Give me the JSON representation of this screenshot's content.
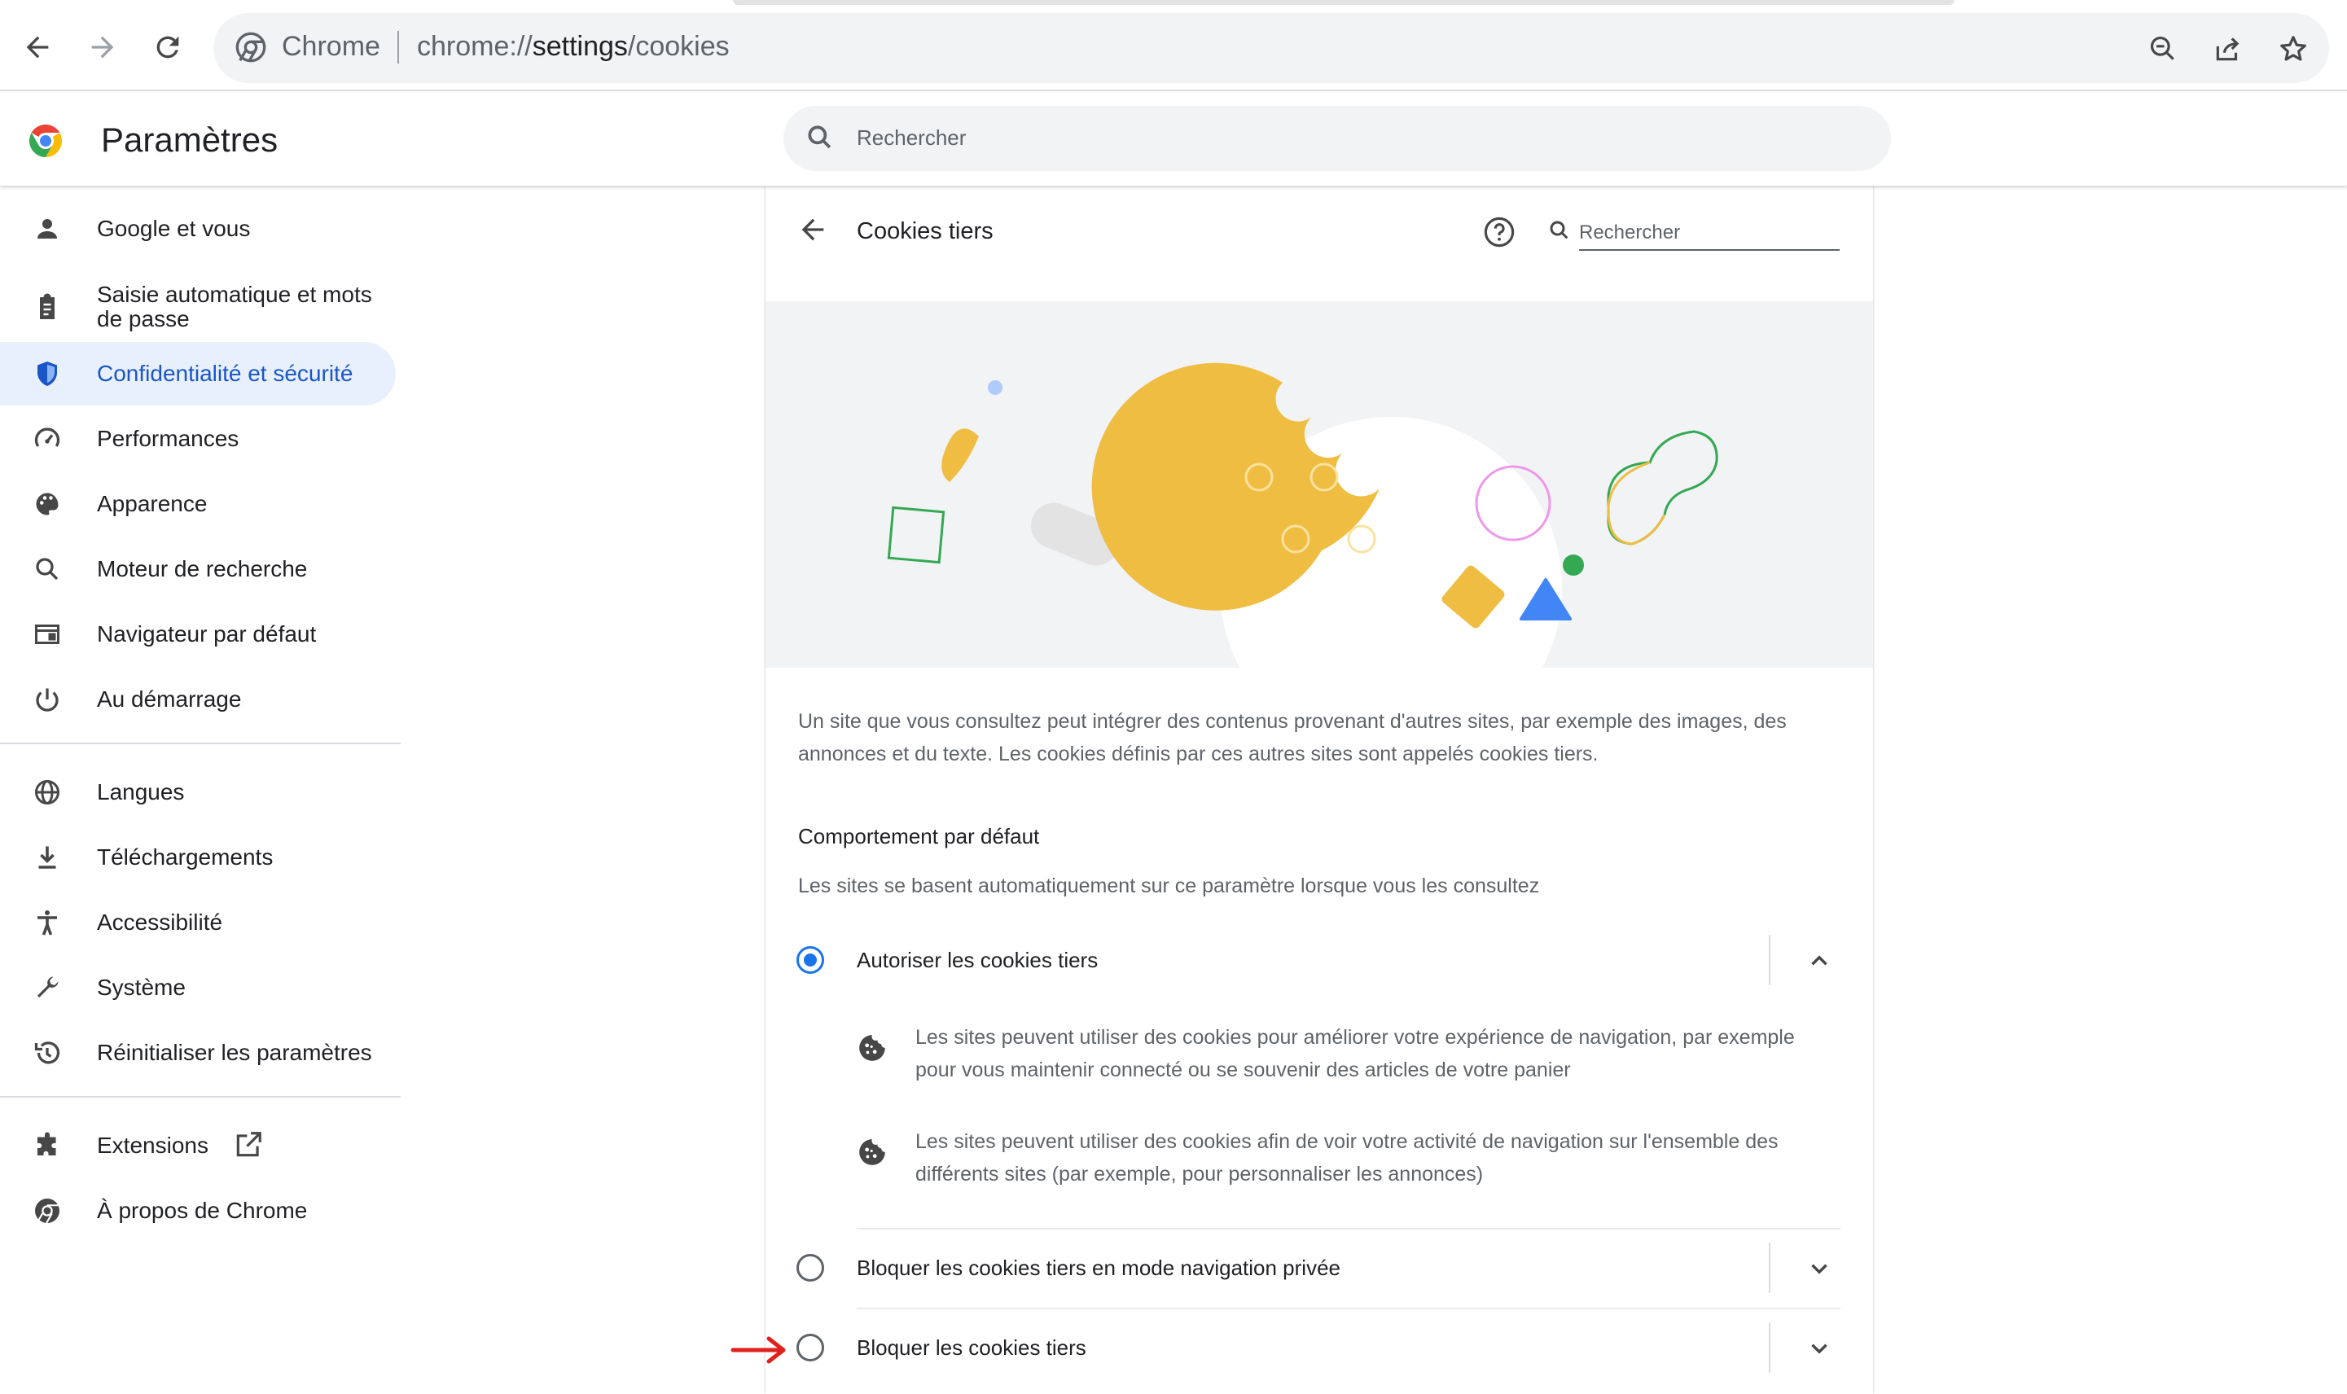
{
  "browser": {
    "site_label": "Chrome",
    "url_scheme": "chrome://",
    "url_host": "settings",
    "url_path": "/cookies"
  },
  "settings": {
    "title": "Paramètres",
    "search_placeholder": "Rechercher"
  },
  "sidebar": {
    "items": [
      {
        "label": "Google et vous",
        "icon": "person-icon"
      },
      {
        "label": "Saisie automatique et mots de passe",
        "icon": "clipboard-icon"
      },
      {
        "label": "Confidentialité et sécurité",
        "icon": "shield-icon",
        "active": true
      },
      {
        "label": "Performances",
        "icon": "speedometer-icon"
      },
      {
        "label": "Apparence",
        "icon": "palette-icon"
      },
      {
        "label": "Moteur de recherche",
        "icon": "search-icon"
      },
      {
        "label": "Navigateur par défaut",
        "icon": "browser-window-icon"
      },
      {
        "label": "Au démarrage",
        "icon": "power-icon"
      },
      {
        "label": "Langues",
        "icon": "globe-icon"
      },
      {
        "label": "Téléchargements",
        "icon": "download-icon"
      },
      {
        "label": "Accessibilité",
        "icon": "accessibility-icon"
      },
      {
        "label": "Système",
        "icon": "wrench-icon"
      },
      {
        "label": "Réinitialiser les paramètres",
        "icon": "history-icon"
      },
      {
        "label": "Extensions",
        "icon": "puzzle-icon"
      },
      {
        "label": "À propos de Chrome",
        "icon": "chrome-icon"
      }
    ]
  },
  "page": {
    "title": "Cookies tiers",
    "search_placeholder": "Rechercher",
    "description": "Un site que vous consultez peut intégrer des contenus provenant d'autres sites, par exemple des images, des annonces et du texte. Les cookies définis par ces autres sites sont appelés cookies tiers.",
    "section_heading": "Comportement par défaut",
    "section_subtext": "Les sites se basent automatiquement sur ce paramètre lorsque vous les consultez",
    "options": [
      {
        "label": "Autoriser les cookies tiers",
        "selected": true,
        "expanded": true
      },
      {
        "label": "Bloquer les cookies tiers en mode navigation privée",
        "selected": false,
        "expanded": false
      },
      {
        "label": "Bloquer les cookies tiers",
        "selected": false,
        "expanded": false
      }
    ],
    "option_details": [
      "Les sites peuvent utiliser des cookies pour améliorer votre expérience de navigation, par exemple pour vous maintenir connecté ou se souvenir des articles de votre panier",
      "Les sites peuvent utiliser des cookies afin de voir votre activité de navigation sur l'ensemble des différents sites (par exemple, pour personnaliser les annonces)"
    ]
  },
  "colors": {
    "accent": "#1a73e8",
    "active_nav_bg": "#e8f0fe",
    "annotation_arrow": "#e0201b"
  }
}
